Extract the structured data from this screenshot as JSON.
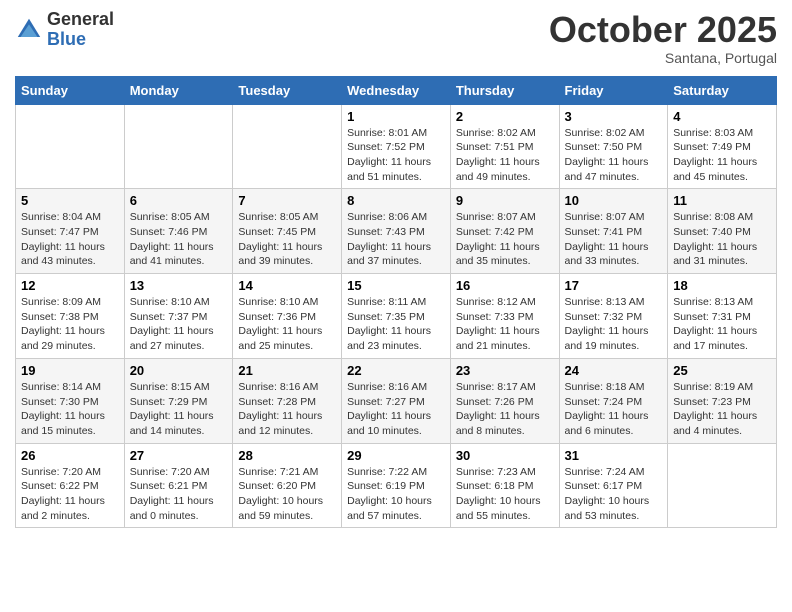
{
  "header": {
    "logo": {
      "general": "General",
      "blue": "Blue"
    },
    "title": "October 2025",
    "subtitle": "Santana, Portugal"
  },
  "weekdays": [
    "Sunday",
    "Monday",
    "Tuesday",
    "Wednesday",
    "Thursday",
    "Friday",
    "Saturday"
  ],
  "weeks": [
    [
      {
        "day": "",
        "info": ""
      },
      {
        "day": "",
        "info": ""
      },
      {
        "day": "",
        "info": ""
      },
      {
        "day": "1",
        "info": "Sunrise: 8:01 AM\nSunset: 7:52 PM\nDaylight: 11 hours and 51 minutes."
      },
      {
        "day": "2",
        "info": "Sunrise: 8:02 AM\nSunset: 7:51 PM\nDaylight: 11 hours and 49 minutes."
      },
      {
        "day": "3",
        "info": "Sunrise: 8:02 AM\nSunset: 7:50 PM\nDaylight: 11 hours and 47 minutes."
      },
      {
        "day": "4",
        "info": "Sunrise: 8:03 AM\nSunset: 7:49 PM\nDaylight: 11 hours and 45 minutes."
      }
    ],
    [
      {
        "day": "5",
        "info": "Sunrise: 8:04 AM\nSunset: 7:47 PM\nDaylight: 11 hours and 43 minutes."
      },
      {
        "day": "6",
        "info": "Sunrise: 8:05 AM\nSunset: 7:46 PM\nDaylight: 11 hours and 41 minutes."
      },
      {
        "day": "7",
        "info": "Sunrise: 8:05 AM\nSunset: 7:45 PM\nDaylight: 11 hours and 39 minutes."
      },
      {
        "day": "8",
        "info": "Sunrise: 8:06 AM\nSunset: 7:43 PM\nDaylight: 11 hours and 37 minutes."
      },
      {
        "day": "9",
        "info": "Sunrise: 8:07 AM\nSunset: 7:42 PM\nDaylight: 11 hours and 35 minutes."
      },
      {
        "day": "10",
        "info": "Sunrise: 8:07 AM\nSunset: 7:41 PM\nDaylight: 11 hours and 33 minutes."
      },
      {
        "day": "11",
        "info": "Sunrise: 8:08 AM\nSunset: 7:40 PM\nDaylight: 11 hours and 31 minutes."
      }
    ],
    [
      {
        "day": "12",
        "info": "Sunrise: 8:09 AM\nSunset: 7:38 PM\nDaylight: 11 hours and 29 minutes."
      },
      {
        "day": "13",
        "info": "Sunrise: 8:10 AM\nSunset: 7:37 PM\nDaylight: 11 hours and 27 minutes."
      },
      {
        "day": "14",
        "info": "Sunrise: 8:10 AM\nSunset: 7:36 PM\nDaylight: 11 hours and 25 minutes."
      },
      {
        "day": "15",
        "info": "Sunrise: 8:11 AM\nSunset: 7:35 PM\nDaylight: 11 hours and 23 minutes."
      },
      {
        "day": "16",
        "info": "Sunrise: 8:12 AM\nSunset: 7:33 PM\nDaylight: 11 hours and 21 minutes."
      },
      {
        "day": "17",
        "info": "Sunrise: 8:13 AM\nSunset: 7:32 PM\nDaylight: 11 hours and 19 minutes."
      },
      {
        "day": "18",
        "info": "Sunrise: 8:13 AM\nSunset: 7:31 PM\nDaylight: 11 hours and 17 minutes."
      }
    ],
    [
      {
        "day": "19",
        "info": "Sunrise: 8:14 AM\nSunset: 7:30 PM\nDaylight: 11 hours and 15 minutes."
      },
      {
        "day": "20",
        "info": "Sunrise: 8:15 AM\nSunset: 7:29 PM\nDaylight: 11 hours and 14 minutes."
      },
      {
        "day": "21",
        "info": "Sunrise: 8:16 AM\nSunset: 7:28 PM\nDaylight: 11 hours and 12 minutes."
      },
      {
        "day": "22",
        "info": "Sunrise: 8:16 AM\nSunset: 7:27 PM\nDaylight: 11 hours and 10 minutes."
      },
      {
        "day": "23",
        "info": "Sunrise: 8:17 AM\nSunset: 7:26 PM\nDaylight: 11 hours and 8 minutes."
      },
      {
        "day": "24",
        "info": "Sunrise: 8:18 AM\nSunset: 7:24 PM\nDaylight: 11 hours and 6 minutes."
      },
      {
        "day": "25",
        "info": "Sunrise: 8:19 AM\nSunset: 7:23 PM\nDaylight: 11 hours and 4 minutes."
      }
    ],
    [
      {
        "day": "26",
        "info": "Sunrise: 7:20 AM\nSunset: 6:22 PM\nDaylight: 11 hours and 2 minutes."
      },
      {
        "day": "27",
        "info": "Sunrise: 7:20 AM\nSunset: 6:21 PM\nDaylight: 11 hours and 0 minutes."
      },
      {
        "day": "28",
        "info": "Sunrise: 7:21 AM\nSunset: 6:20 PM\nDaylight: 10 hours and 59 minutes."
      },
      {
        "day": "29",
        "info": "Sunrise: 7:22 AM\nSunset: 6:19 PM\nDaylight: 10 hours and 57 minutes."
      },
      {
        "day": "30",
        "info": "Sunrise: 7:23 AM\nSunset: 6:18 PM\nDaylight: 10 hours and 55 minutes."
      },
      {
        "day": "31",
        "info": "Sunrise: 7:24 AM\nSunset: 6:17 PM\nDaylight: 10 hours and 53 minutes."
      },
      {
        "day": "",
        "info": ""
      }
    ]
  ]
}
